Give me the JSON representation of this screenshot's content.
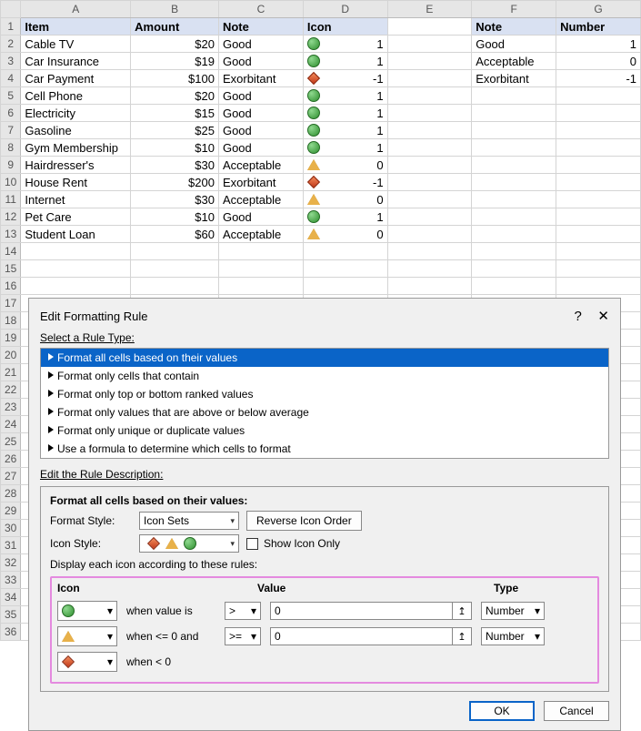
{
  "columns": [
    "A",
    "B",
    "C",
    "D",
    "E",
    "F",
    "G"
  ],
  "headers": {
    "A": "Item",
    "B": "Amount",
    "C": "Note",
    "D": "Icon",
    "F": "Note",
    "G": "Number"
  },
  "rows": [
    {
      "item": "Cable TV",
      "amount": "$20",
      "note": "Good",
      "icon": "green",
      "val": "1"
    },
    {
      "item": "Car Insurance",
      "amount": "$19",
      "note": "Good",
      "icon": "green",
      "val": "1"
    },
    {
      "item": "Car Payment",
      "amount": "$100",
      "note": "Exorbitant",
      "icon": "red",
      "val": "-1"
    },
    {
      "item": "Cell Phone",
      "amount": "$20",
      "note": "Good",
      "icon": "green",
      "val": "1"
    },
    {
      "item": "Electricity",
      "amount": "$15",
      "note": "Good",
      "icon": "green",
      "val": "1"
    },
    {
      "item": "Gasoline",
      "amount": "$25",
      "note": "Good",
      "icon": "green",
      "val": "1"
    },
    {
      "item": "Gym Membership",
      "amount": "$10",
      "note": "Good",
      "icon": "green",
      "val": "1"
    },
    {
      "item": "Hairdresser's",
      "amount": "$30",
      "note": "Acceptable",
      "icon": "yellow",
      "val": "0"
    },
    {
      "item": "House Rent",
      "amount": "$200",
      "note": "Exorbitant",
      "icon": "red",
      "val": "-1"
    },
    {
      "item": "Internet",
      "amount": "$30",
      "note": "Acceptable",
      "icon": "yellow",
      "val": "0"
    },
    {
      "item": "Pet Care",
      "amount": "$10",
      "note": "Good",
      "icon": "green",
      "val": "1"
    },
    {
      "item": "Student Loan",
      "amount": "$60",
      "note": "Acceptable",
      "icon": "yellow",
      "val": "0"
    }
  ],
  "lookup": [
    {
      "note": "Good",
      "num": "1"
    },
    {
      "note": "Acceptable",
      "num": "0"
    },
    {
      "note": "Exorbitant",
      "num": "-1"
    }
  ],
  "dialog": {
    "title": "Edit Formatting Rule",
    "help": "?",
    "close": "✕",
    "select_label": "Select a Rule Type:",
    "rule_types": [
      "Format all cells based on their values",
      "Format only cells that contain",
      "Format only top or bottom ranked values",
      "Format only values that are above or below average",
      "Format only unique or duplicate values",
      "Use a formula to determine which cells to format"
    ],
    "edit_label": "Edit the Rule Description:",
    "desc_title": "Format all cells based on their values:",
    "format_style_label": "Format Style:",
    "format_style_value": "Icon Sets",
    "reverse_btn": "Reverse Icon Order",
    "icon_style_label": "Icon Style:",
    "show_icon_only": "Show Icon Only",
    "display_label": "Display each icon according to these rules:",
    "cols": {
      "icon": "Icon",
      "value": "Value",
      "type": "Type"
    },
    "rules": [
      {
        "icon": "green",
        "text": "when value is",
        "op": ">",
        "val": "0",
        "type": "Number"
      },
      {
        "icon": "yellow",
        "text": "when <= 0 and",
        "op": ">=",
        "val": "0",
        "type": "Number"
      },
      {
        "icon": "red",
        "text": "when < 0"
      }
    ],
    "ok": "OK",
    "cancel": "Cancel"
  }
}
